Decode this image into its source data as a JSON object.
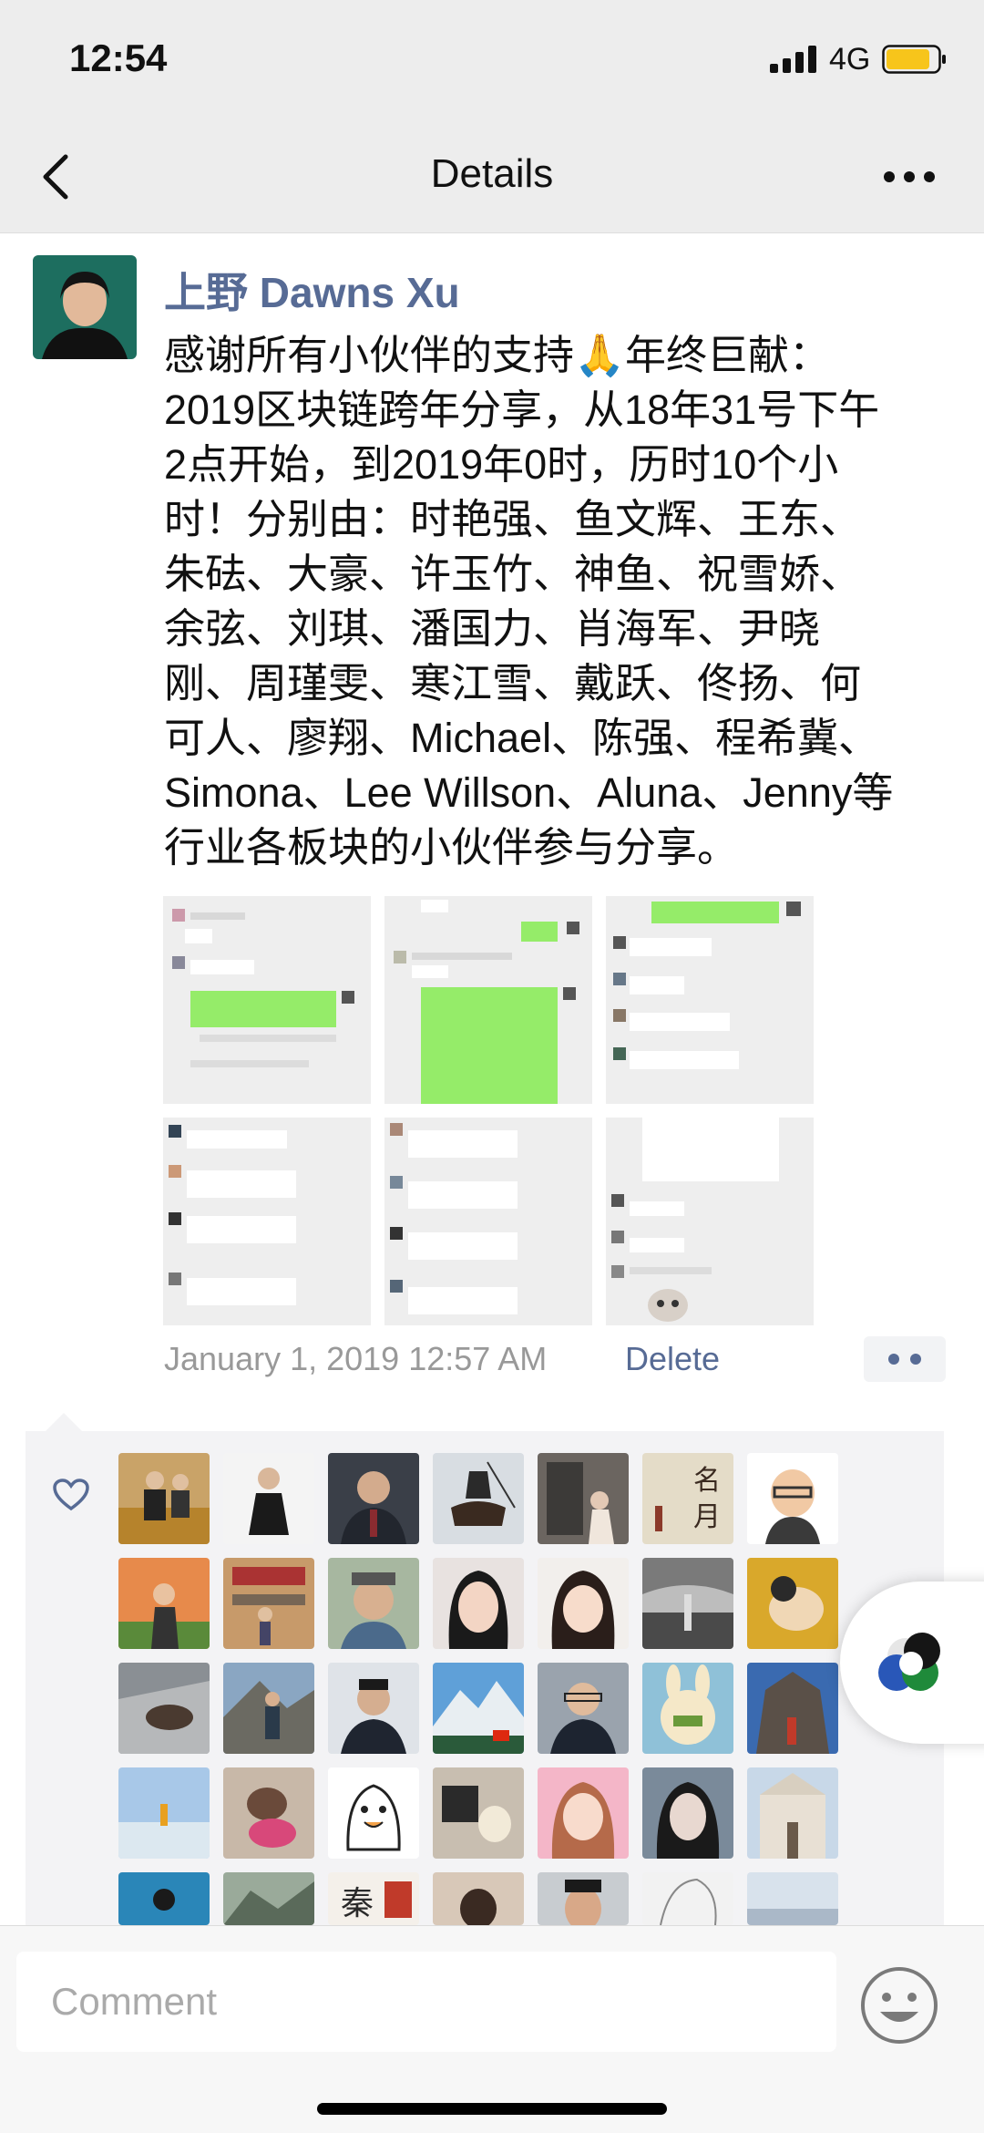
{
  "status_bar": {
    "time": "12:54",
    "network": "4G"
  },
  "nav": {
    "title": "Details"
  },
  "post": {
    "author": "上野 Dawns Xu",
    "text": "感谢所有小伙伴的支持🙏年终巨献：\n2019区块链跨年分享，从18年31号下午\n2点开始，到2019年0时，历时10个小\n时！分别由：时艳强、鱼文辉、王东、\n朱砝、大豪、许玉竹、神鱼、祝雪娇、\n余弦、刘琪、潘国力、肖海军、尹晓\n刚、周瑾雯、寒江雪、戴跃、佟扬、何\n可人、廖翔、Michael、陈强、程希冀、\nSimona、Lee Willson、Aluna、Jenny等\n行业各板块的小伙伴参与分享。",
    "timestamp": "January 1, 2019 12:57 AM",
    "delete_label": "Delete",
    "image_count": 6
  },
  "likes": {
    "avatar_count": 35
  },
  "comment": {
    "placeholder": "Comment"
  },
  "colors": {
    "link": "#576b95",
    "wechat_green": "#95ec69",
    "bar_bg": "#ededed"
  }
}
